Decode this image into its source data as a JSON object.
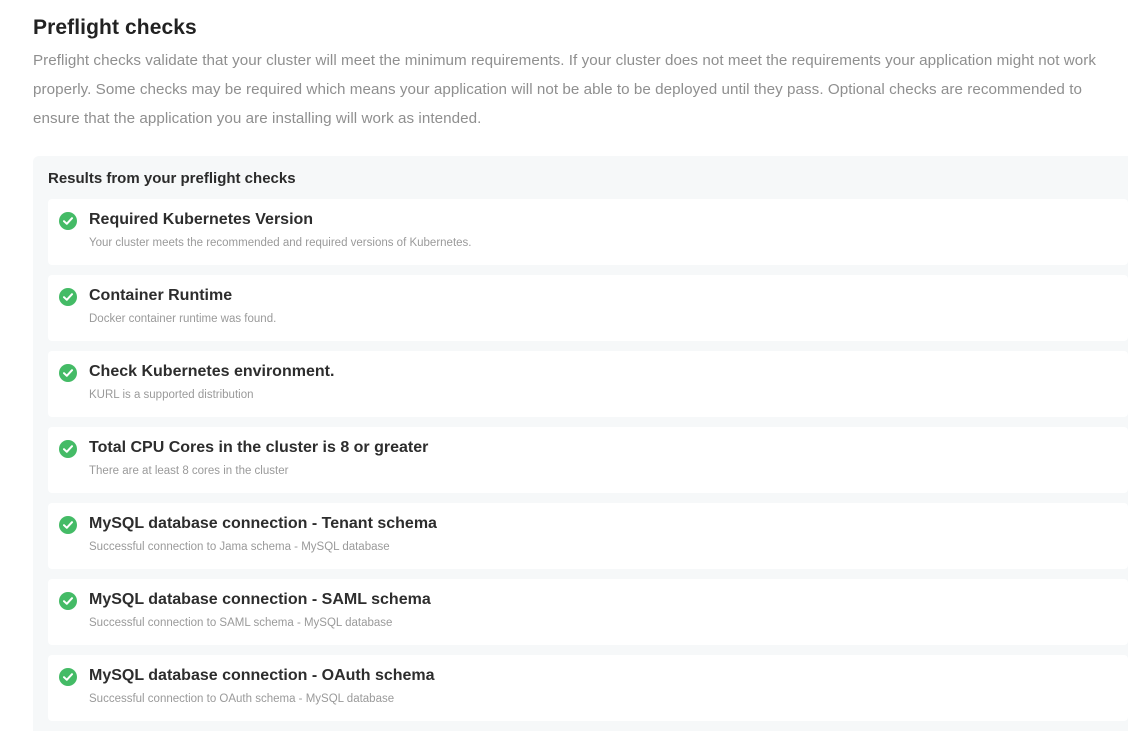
{
  "page": {
    "title": "Preflight checks",
    "description": "Preflight checks validate that your cluster will meet the minimum requirements. If your cluster does not meet the requirements your application might not work properly. Some checks may be required which means your application will not be able to be deployed until they pass. Optional checks are recommended to ensure that the application you are installing will work as intended."
  },
  "results": {
    "title": "Results from your preflight checks",
    "status_color": "#44bb66",
    "status_icon": "check-circle-icon",
    "items": [
      {
        "title": "Required Kubernetes Version",
        "message": "Your cluster meets the recommended and required versions of Kubernetes.",
        "status": "pass"
      },
      {
        "title": "Container Runtime",
        "message": "Docker container runtime was found.",
        "status": "pass"
      },
      {
        "title": "Check Kubernetes environment.",
        "message": "KURL is a supported distribution",
        "status": "pass"
      },
      {
        "title": "Total CPU Cores in the cluster is 8 or greater",
        "message": "There are at least 8 cores in the cluster",
        "status": "pass"
      },
      {
        "title": "MySQL database connection - Tenant schema",
        "message": "Successful connection to Jama schema - MySQL database",
        "status": "pass"
      },
      {
        "title": "MySQL database connection - SAML schema",
        "message": "Successful connection to SAML schema - MySQL database",
        "status": "pass"
      },
      {
        "title": "MySQL database connection - OAuth schema",
        "message": "Successful connection to OAuth schema - MySQL database",
        "status": "pass"
      }
    ]
  }
}
